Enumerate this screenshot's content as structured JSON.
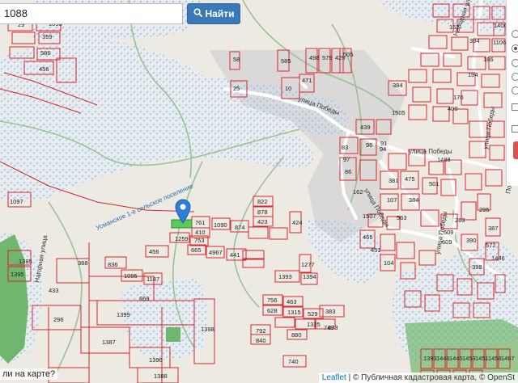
{
  "search": {
    "value": "1088",
    "button_label": "Найти",
    "button_icon": "search-icon"
  },
  "map": {
    "streets": [
      {
        "label": "улица Победы"
      },
      {
        "label": "улица Победы"
      },
      {
        "label": "улица Победы"
      },
      {
        "label": "улица Победы"
      },
      {
        "label": "улица Победы"
      },
      {
        "label": "Усманское 1-е сельское поселение"
      },
      {
        "label": "Нагорная улица"
      },
      {
        "label": "Народная ул"
      },
      {
        "label": "Полевая улица"
      }
    ],
    "parcels": [
      "1088",
      "359",
      "29",
      "586",
      "456",
      "1098",
      "58",
      "585",
      "498",
      "579",
      "429",
      "505",
      "25",
      "10",
      "471",
      "439",
      "96",
      "384",
      "91",
      "94",
      "83",
      "97",
      "86",
      "162",
      "107",
      "384",
      "381",
      "475",
      "501",
      "563",
      "465",
      "451",
      "104",
      "609",
      "263",
      "609",
      "390",
      "822",
      "878",
      "423",
      "761",
      "1090",
      "874",
      "410",
      "1259",
      "753",
      "424",
      "456",
      "665",
      "4967",
      "441",
      "836",
      "1095",
      "1187",
      "388",
      "669",
      "1385",
      "1395",
      "433",
      "296",
      "1399",
      "1387",
      "1396",
      "1398",
      "1393",
      "1394",
      "1277",
      "756",
      "463",
      "628",
      "1315",
      "529",
      "792",
      "840",
      "880",
      "749",
      "383",
      "1325",
      "873",
      "740",
      "1097",
      "1388",
      "1393",
      "1446",
      "1445",
      "1453",
      "1451",
      "1458",
      "1467",
      "1453",
      "1478",
      "1447",
      "1446",
      "572",
      "398",
      "295",
      "387",
      "1488",
      "1507",
      "1505",
      "400",
      "162",
      "394",
      "170",
      "194",
      "186",
      "1106",
      "1400",
      "1424",
      "1416",
      "1449",
      "1397"
    ]
  },
  "sidebar": {
    "radio_selected_index": 1
  },
  "bottom_link": "ли на карте?",
  "attribution": {
    "leaflet": "Leaflet",
    "separator": " | © ",
    "source": "Публичная кадастровая карта",
    "osm": "© OpenSt"
  },
  "colors": {
    "parcel": "#d9262a",
    "water": "#9ec6e0",
    "green": "#5cae59",
    "button": "#3a78b8",
    "marker": "#2e7dd6"
  }
}
